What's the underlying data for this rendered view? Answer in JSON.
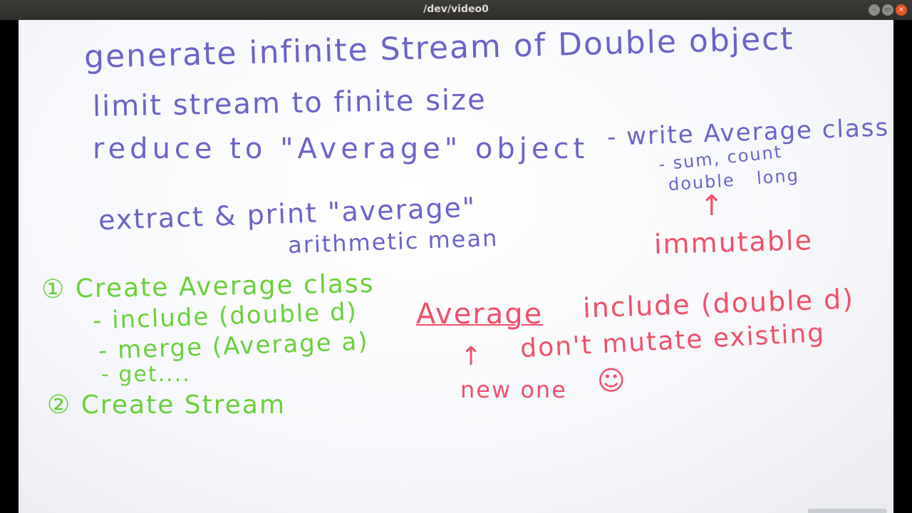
{
  "window": {
    "title": "/dev/video0",
    "buttons": {
      "minimize": "–",
      "maximize": "▭",
      "close": "×"
    }
  },
  "board": {
    "blue": {
      "line1": "generate infinite Stream of Double object",
      "line2": "limit stream to finite size",
      "line3a": "reduce to \"Average\" object",
      "line3b": "- write Average class",
      "fields": "- sum, count",
      "types_double": "double",
      "types_long": "long",
      "line4": "extract & print \"average\"",
      "line4b": "arithmetic mean"
    },
    "green": {
      "step1": "① Create Average class",
      "include": "- include (double d)",
      "merge": "- merge (Average a)",
      "get": "- get....",
      "step2": "② Create Stream"
    },
    "red": {
      "arrow_up": "↑",
      "immutable": "immutable",
      "average_word": "Average",
      "include_sig": "include (double d)",
      "arrow_up2": "↑",
      "dont_mutate": "don't mutate existing",
      "new_one": "new one",
      "smiley": "☺"
    }
  }
}
